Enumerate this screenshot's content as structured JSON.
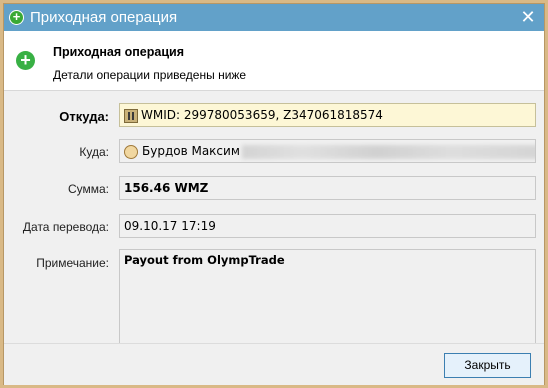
{
  "window": {
    "title": "Приходная операция",
    "close_glyph": "✕"
  },
  "header": {
    "title": "Приходная операция",
    "subtitle": "Детали операции приведены ниже"
  },
  "fields": {
    "from": {
      "label": "Откуда:",
      "value": "WMID: 299780053659, Z347061818574"
    },
    "to": {
      "label": "Куда:",
      "value": "Бурдов Максим"
    },
    "amount": {
      "label": "Сумма:",
      "value": "156.46 WMZ"
    },
    "date": {
      "label": "Дата перевода:",
      "value": "09.10.17 17:19"
    },
    "note": {
      "label": "Примечание:",
      "value": "Payout from OlympTrade"
    }
  },
  "footer": {
    "close_label": "Закрыть"
  },
  "colors": {
    "titlebar": "#62a1c9",
    "highlight": "#fdf7d6",
    "accent_button": "#3c7fb1"
  }
}
